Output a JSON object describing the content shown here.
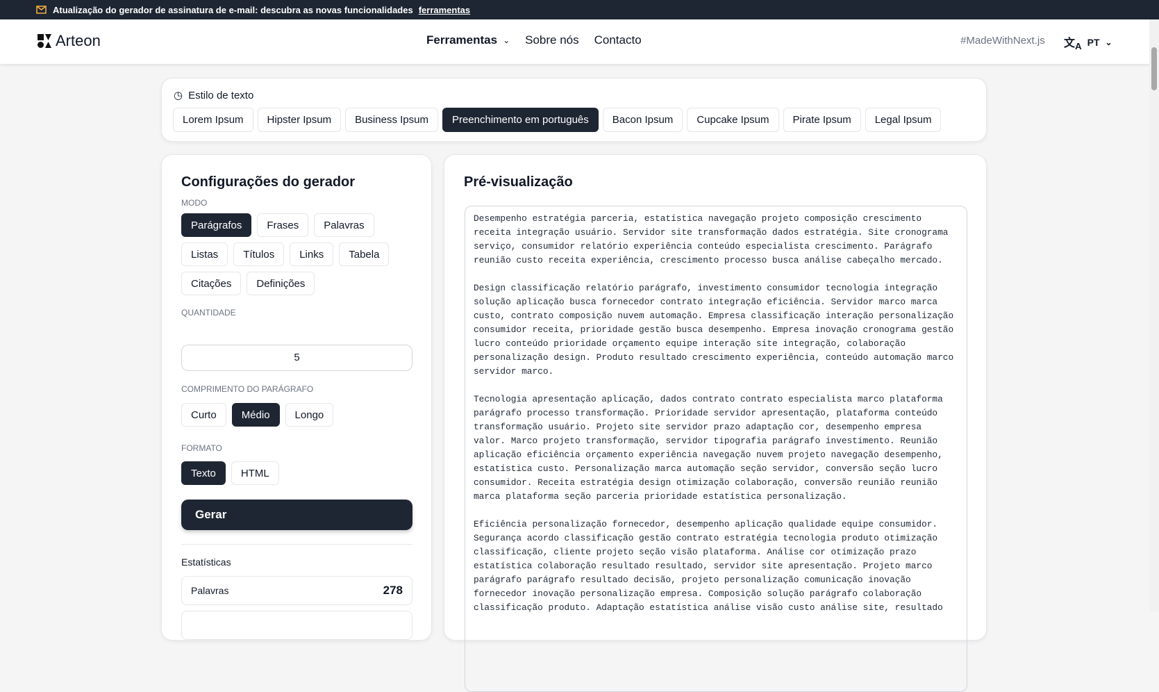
{
  "banner": {
    "text": "Atualização do gerador de assinatura de e-mail: descubra as novas funcionalidades",
    "link": "ferramentas"
  },
  "nav": {
    "brand": "Arteon",
    "links": [
      "Ferramentas",
      "Sobre nós",
      "Contacto"
    ],
    "made_with": "#MadeWithNext.js",
    "lang": "PT"
  },
  "style": {
    "label": "Estilo de texto",
    "options": [
      "Lorem Ipsum",
      "Hipster Ipsum",
      "Business Ipsum",
      "Preenchimento em português",
      "Bacon Ipsum",
      "Cupcake Ipsum",
      "Pirate Ipsum",
      "Legal Ipsum"
    ],
    "selected": 3
  },
  "settings": {
    "title": "Configurações do gerador",
    "mode_label": "MODO",
    "modes": [
      "Parágrafos",
      "Frases",
      "Palavras",
      "Listas",
      "Títulos",
      "Links",
      "Tabela",
      "Citações",
      "Definições"
    ],
    "mode_selected": 0,
    "qty_label": "QUANTIDADE",
    "qty": "5",
    "length_label": "COMPRIMENTO DO PARÁGRAFO",
    "lengths": [
      "Curto",
      "Médio",
      "Longo"
    ],
    "length_selected": 1,
    "format_label": "FORMATO",
    "formats": [
      "Texto",
      "HTML"
    ],
    "format_selected": 0,
    "generate": "Gerar",
    "stats_title": "Estatísticas",
    "stats": [
      {
        "label": "Palavras",
        "value": "278"
      }
    ]
  },
  "preview": {
    "title": "Pré-visualização",
    "paragraphs": [
      [
        "Desempenho estratégia parceria, estatística navegação projeto composição crescimento",
        "receita integração usuário. Servidor site transformação dados estratégia. Site cronograma",
        "serviço, consumidor relatório experiência conteúdo especialista crescimento. Parágrafo",
        "reunião custo receita experiência, crescimento processo busca análise cabeçalho mercado."
      ],
      [
        "Design classificação relatório parágrafo, investimento consumidor tecnologia integração",
        "solução aplicação busca fornecedor contrato integração eficiência. Servidor marco marca",
        "custo, contrato composição nuvem automação. Empresa classificação interação personalização",
        "consumidor receita, prioridade gestão busca desempenho. Empresa inovação cronograma gestão",
        "lucro conteúdo prioridade orçamento equipe interação site integração, colaboração",
        "personalização design. Produto resultado crescimento experiência, conteúdo automação marco",
        "servidor marco."
      ],
      [
        "Tecnologia apresentação aplicação, dados contrato contrato especialista marco plataforma",
        "parágrafo processo transformação. Prioridade servidor apresentação, plataforma conteúdo",
        "transformação usuário. Projeto site servidor prazo adaptação cor, desempenho empresa",
        "valor. Marco projeto transformação, servidor tipografia parágrafo investimento. Reunião",
        "aplicação eficiência orçamento experiência navegação nuvem projeto navegação desempenho,",
        "estatística custo. Personalização marca automação seção servidor, conversão seção lucro",
        "consumidor. Receita estratégia design otimização colaboração, conversão reunião reunião",
        "marca plataforma seção parceria prioridade estatística personalização."
      ],
      [
        "Eficiência personalização fornecedor, desempenho aplicação qualidade equipe consumidor.",
        "Segurança acordo classificação gestão contrato estratégia tecnologia produto otimização",
        "classificação, cliente projeto seção visão plataforma. Análise cor otimização prazo",
        "estatística colaboração resultado resultado, servidor site apresentação. Projeto marco",
        "parágrafo parágrafo resultado decisão, projeto personalização comunicação inovação",
        "fornecedor inovação personalização empresa. Composição solução parágrafo colaboração",
        "classificação produto. Adaptação estatística análise visão custo análise site, resultado"
      ]
    ]
  },
  "colors": {
    "dark": "#1e2633",
    "banner_icon": "#f5b041"
  }
}
